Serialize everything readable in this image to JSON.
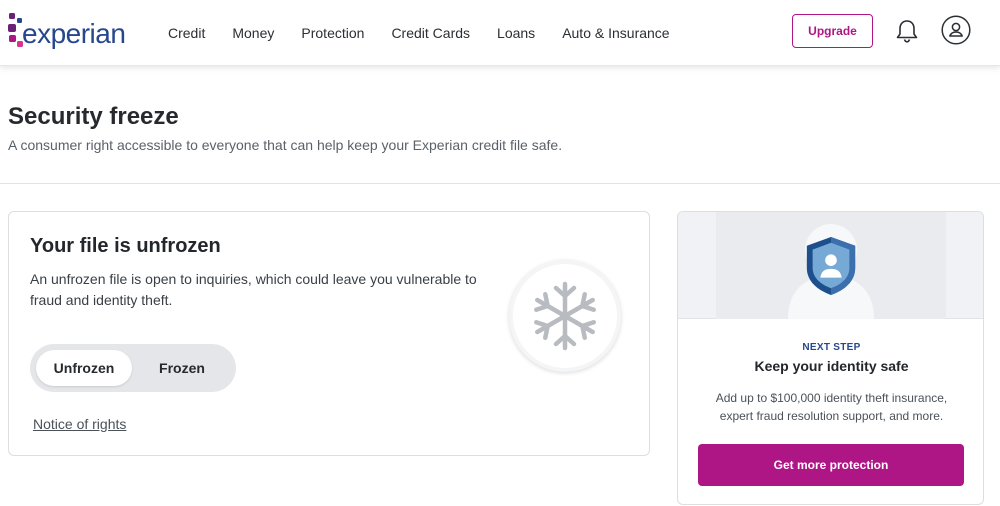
{
  "header": {
    "logo_text": "experian",
    "logo_tm": ".",
    "nav": [
      "Credit",
      "Money",
      "Protection",
      "Credit Cards",
      "Loans",
      "Auto & Insurance"
    ],
    "upgrade_label": "Upgrade",
    "notifications_icon": "bell-icon",
    "account_icon": "user-circle-icon"
  },
  "page": {
    "title": "Security freeze",
    "subtitle": "A consumer right accessible to everyone that can help keep your Experian credit file safe."
  },
  "freeze_card": {
    "title": "Your file is unfrozen",
    "description": "An unfrozen file is open to inquiries, which could leave you vulnerable to fraud and identity theft.",
    "toggle": {
      "options": [
        "Unfrozen",
        "Frozen"
      ],
      "selected": "Unfrozen"
    },
    "notice_link": "Notice of rights",
    "status_icon": "snowflake-icon"
  },
  "side_card": {
    "hero_icon": "shield-person-icon",
    "eyebrow": "NEXT STEP",
    "title": "Keep your identity safe",
    "description": "Add up to $100,000 identity theft insurance, expert fraud resolution support, and more.",
    "cta_label": "Get more protection"
  },
  "colors": {
    "brand_magenta": "#af1685",
    "brand_blue": "#26478d",
    "brand_purple": "#6d2077"
  }
}
